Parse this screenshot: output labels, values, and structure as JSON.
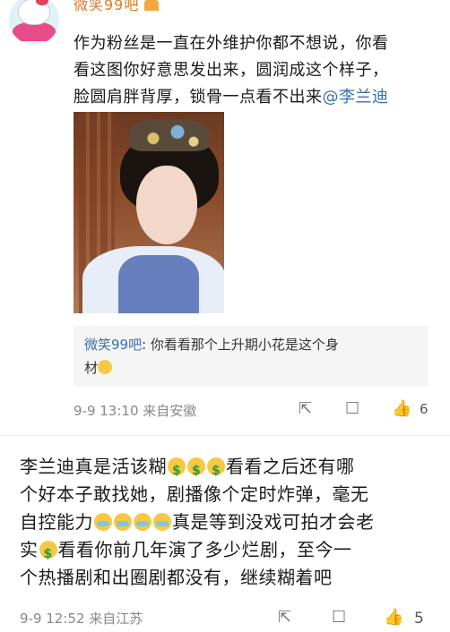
{
  "comment1": {
    "username": "微笑99吧",
    "text_lines": [
      "作为粉丝是一直在外维护你都不想说，你看",
      "看这图你好意思发出来，圆润成这个样子，",
      "脸圆肩胖背厚，锁骨一点看不出来"
    ],
    "mention": "@李兰迪",
    "reply": {
      "name": "微笑99吧",
      "separator": ": ",
      "text": "你看看那个上升期小花是这个身",
      "text2": "材"
    },
    "meta": "9-9 13:10  来自安徽",
    "likes": "6"
  },
  "comment2": {
    "text_part1": "李兰迪真是活该糊",
    "text_part2": "看看之后还有哪",
    "line2": "个好本子敢找她，剧播像个定时炸弹，毫无",
    "line3_part1": "自控能力",
    "line3_part2": "真是等到没戏可拍才会老",
    "line4_part1": "实",
    "line4_part2": "看看你前几年演了多少烂剧，至今一",
    "line5": "个热播剧和出圈剧都没有，继续糊着吧",
    "meta": "9-9 12:52  来自江苏",
    "likes": "5"
  },
  "icons": {
    "share": "share-icon",
    "comment": "comment-icon",
    "like": "thumbs-up-icon"
  },
  "colors": {
    "link": "#3a6fb0",
    "meta": "#888888",
    "reply_bg": "#f5f5f5"
  }
}
